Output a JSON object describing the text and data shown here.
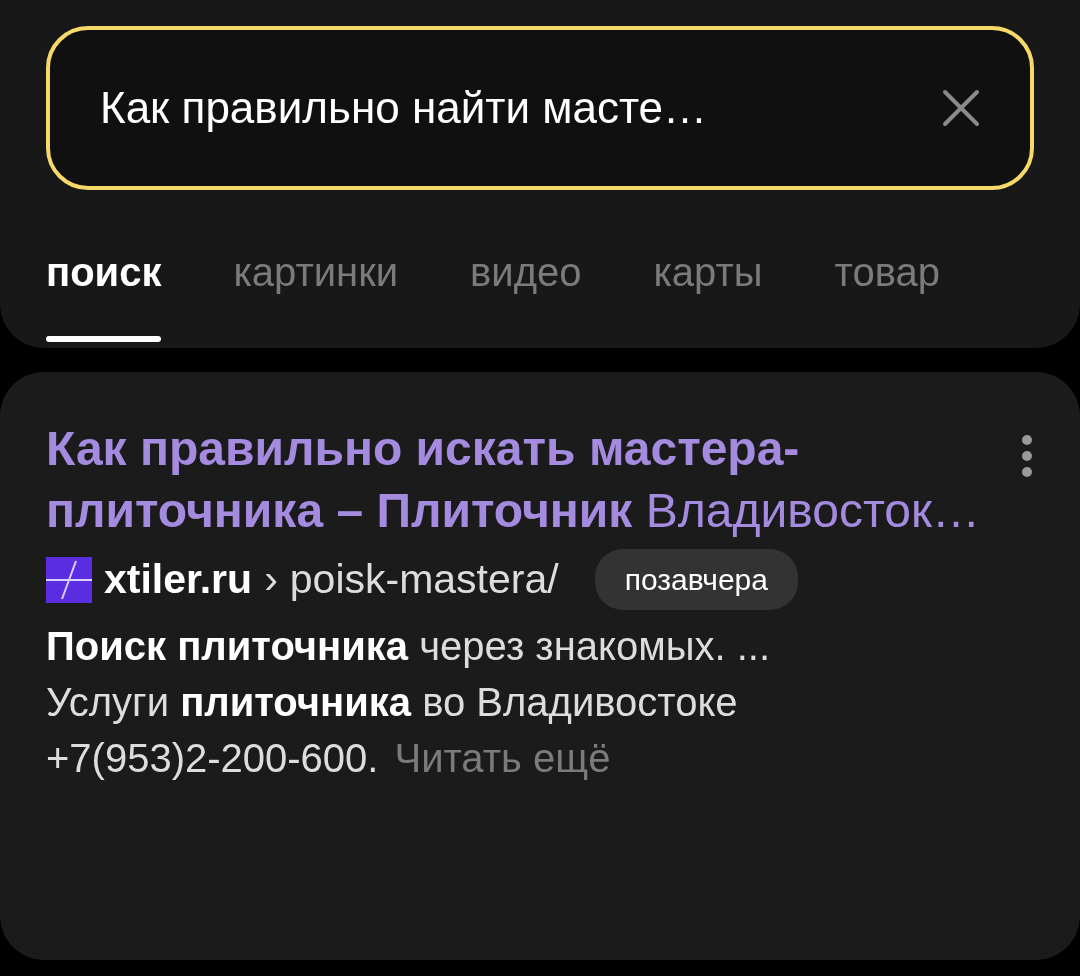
{
  "search": {
    "value": "Как правильно найти масте…"
  },
  "tabs": [
    {
      "label": "поиск",
      "selected": true
    },
    {
      "label": "картинки",
      "selected": false
    },
    {
      "label": "видео",
      "selected": false
    },
    {
      "label": "карты",
      "selected": false
    },
    {
      "label": "товар",
      "selected": false
    }
  ],
  "result": {
    "title": "**Как правильно искать мастера-плиточника – Плиточник** Владивосток…",
    "domain": "xtiler.ru",
    "separator": "›",
    "path": "poisk-mastera/",
    "date": "позавчера",
    "snippet_lines": [
      "**Поиск плиточника** через знакомых. ...",
      "Услуги **плиточника** во Владивостоке",
      "+7(953)2-200-600."
    ],
    "more": "Читать ещё"
  }
}
